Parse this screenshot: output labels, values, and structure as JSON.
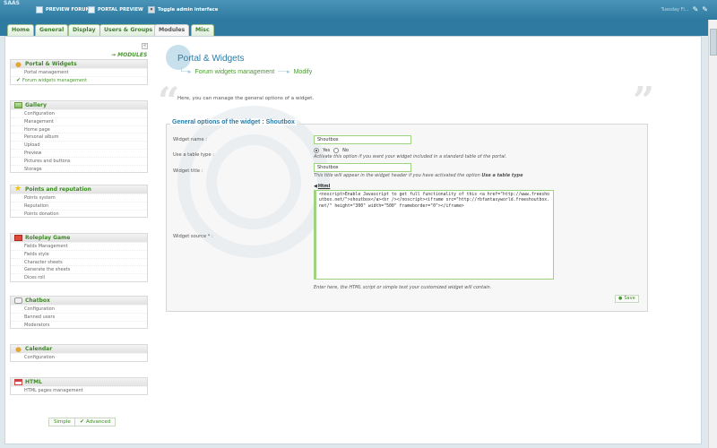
{
  "topbar": {
    "brand": "SAAS",
    "links": [
      "PREVIEW FORUM",
      "PORTAL PREVIEW",
      "Toggle admin interface"
    ],
    "right_text": "Tuesday Fl..."
  },
  "tabs": [
    "Home",
    "General",
    "Display",
    "Users & Groups",
    "Modules",
    "Misc"
  ],
  "sidebar": {
    "modules_link": "→ MODULES",
    "sections": [
      {
        "title": "Portal & Widgets",
        "items": [
          "Portal management",
          "Forum widgets management"
        ]
      },
      {
        "title": "Gallery",
        "items": [
          "Configuration",
          "Management",
          "Home page",
          "Personal album",
          "Upload",
          "Preview",
          "Pictures and buttons",
          "Storage"
        ]
      },
      {
        "title": "Points and reputation",
        "items": [
          "Points system",
          "Reputation",
          "Points donation"
        ]
      },
      {
        "title": "Roleplay Game",
        "items": [
          "Fields Management",
          "Fields style",
          "Character sheets",
          "Generate the sheets",
          "Dices roll"
        ]
      },
      {
        "title": "Chatbox",
        "items": [
          "Configuration",
          "Banned users",
          "Moderators"
        ]
      },
      {
        "title": "Calendar",
        "items": [
          "Configuration"
        ]
      },
      {
        "title": "HTML",
        "items": [
          "HTML pages management"
        ]
      }
    ],
    "buttons": {
      "simple": "Simple",
      "advanced": "Advanced"
    }
  },
  "page": {
    "title": "Portal & Widgets",
    "breadcrumb": [
      "Forum widgets management",
      "Modify"
    ],
    "intro": "Here, you can manage the general options of a widget.",
    "legend": "General options of the widget : Shoutbox"
  },
  "form": {
    "widget_name_label": "Widget name :",
    "widget_name_value": "Shoutbox",
    "table_type_label": "Use a table type :",
    "yes": "Yes",
    "no": "No",
    "table_type_hint": "Activate this option if you want your widget included in a standard table of the portal.",
    "widget_title_label": "Widget title :",
    "widget_title_value": "Shoutbox",
    "widget_title_hint_pre": "This title will appear in the widget header if you have activated the option",
    "widget_title_hint_bold": "Use a table type",
    "source_label": "Widget source * :",
    "html_button": "Html",
    "source_value": "<noscript>Enable Javascript to get full functionality of this <a href=\"http://www.freeshoutbox.net/\">shoutbox</a><br /></noscript><iframe src=\"http://rbfantasyworld.freeshoutbox.net/\" height=\"300\" width=\"500\" frameborder=\"0\"></iframe>",
    "source_hint": "Enter here, the HTML script or simple text your customized widget will contain.",
    "save": "Save"
  }
}
